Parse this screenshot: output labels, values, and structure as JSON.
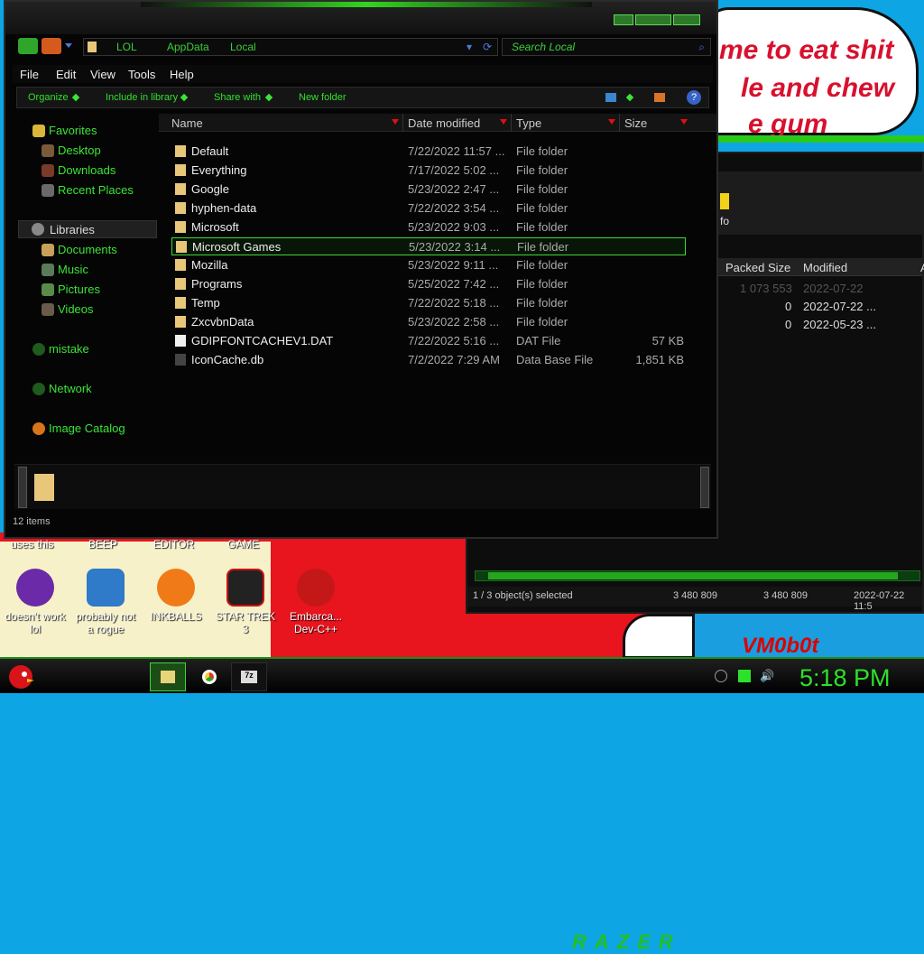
{
  "desktop": {
    "bubble_lines": [
      "me to eat shit",
      "le and chew",
      "e gum"
    ],
    "corner_text": "VM0b0t",
    "top_labels": [
      "uses this",
      "BEEP",
      "EDITOR",
      "GAME"
    ],
    "icons": [
      {
        "label": "doesn't work lol",
        "icon": "yahoo-messenger-icon"
      },
      {
        "label": "probably not a rogue",
        "icon": "gears-monitor-icon"
      },
      {
        "label": "INKBALLS",
        "icon": "inkball-icon"
      },
      {
        "label": "STAR TREK 3",
        "icon": "star-wars-icon"
      },
      {
        "label": "Embarca... Dev-C++",
        "icon": "devcpp-icon"
      }
    ]
  },
  "archive_window": {
    "info": "fo",
    "columns": [
      "Packed Size",
      "Modified",
      "A"
    ],
    "rows": [
      {
        "packed": "1 073 553",
        "modified": "2022-07-22"
      },
      {
        "packed": "0",
        "modified": "2022-07-22 ..."
      },
      {
        "packed": "0",
        "modified": "2022-05-23 ..."
      }
    ],
    "status": {
      "selected": "1 / 3 object(s) selected",
      "size1": "3 480 809",
      "size2": "3 480 809",
      "date": "2022-07-22 11:5"
    }
  },
  "explorer": {
    "address": [
      "LOL",
      "AppData",
      "Local"
    ],
    "search_placeholder": "Search Local",
    "menu": [
      "File",
      "Edit",
      "View",
      "Tools",
      "Help"
    ],
    "commands": [
      "Organize",
      "Include in library",
      "Share with",
      "New folder"
    ],
    "nav": {
      "favorites": "Favorites",
      "favorite_items": [
        "Desktop",
        "Downloads",
        "Recent Places"
      ],
      "libraries": "Libraries",
      "library_items": [
        "Documents",
        "Music",
        "Pictures",
        "Videos"
      ],
      "homegroup": "mistake",
      "network": "Network",
      "catalog": "Image Catalog"
    },
    "columns": {
      "name": "Name",
      "date": "Date modified",
      "type": "Type",
      "size": "Size"
    },
    "files": [
      {
        "name": "Default",
        "date": "7/22/2022 11:57 ...",
        "type": "File folder",
        "size": ""
      },
      {
        "name": "Everything",
        "date": "7/17/2022 5:02 ...",
        "type": "File folder",
        "size": ""
      },
      {
        "name": "Google",
        "date": "5/23/2022 2:47 ...",
        "type": "File folder",
        "size": ""
      },
      {
        "name": "hyphen-data",
        "date": "7/22/2022 3:54 ...",
        "type": "File folder",
        "size": ""
      },
      {
        "name": "Microsoft",
        "date": "5/23/2022 9:03 ...",
        "type": "File folder",
        "size": ""
      },
      {
        "name": "Microsoft Games",
        "date": "5/23/2022 3:14 ...",
        "type": "File folder",
        "size": "",
        "selected": true
      },
      {
        "name": "Mozilla",
        "date": "5/23/2022 9:11 ...",
        "type": "File folder",
        "size": ""
      },
      {
        "name": "Programs",
        "date": "5/25/2022 7:42 ...",
        "type": "File folder",
        "size": ""
      },
      {
        "name": "Temp",
        "date": "7/22/2022 5:18 ...",
        "type": "File folder",
        "size": ""
      },
      {
        "name": "ZxcvbnData",
        "date": "5/23/2022 2:58 ...",
        "type": "File folder",
        "size": ""
      },
      {
        "name": "GDIPFONTCACHEV1.DAT",
        "date": "7/22/2022 5:16 ...",
        "type": "DAT File",
        "size": "57 KB"
      },
      {
        "name": "IconCache.db",
        "date": "7/2/2022 7:29 AM",
        "type": "Data Base File",
        "size": "1,851 KB"
      }
    ],
    "status": "12 items",
    "brand": "RAZER"
  },
  "taskbar": {
    "clock": "5:18 PM"
  },
  "colors": {
    "accent": "#2ce12a",
    "background": "#050505"
  }
}
